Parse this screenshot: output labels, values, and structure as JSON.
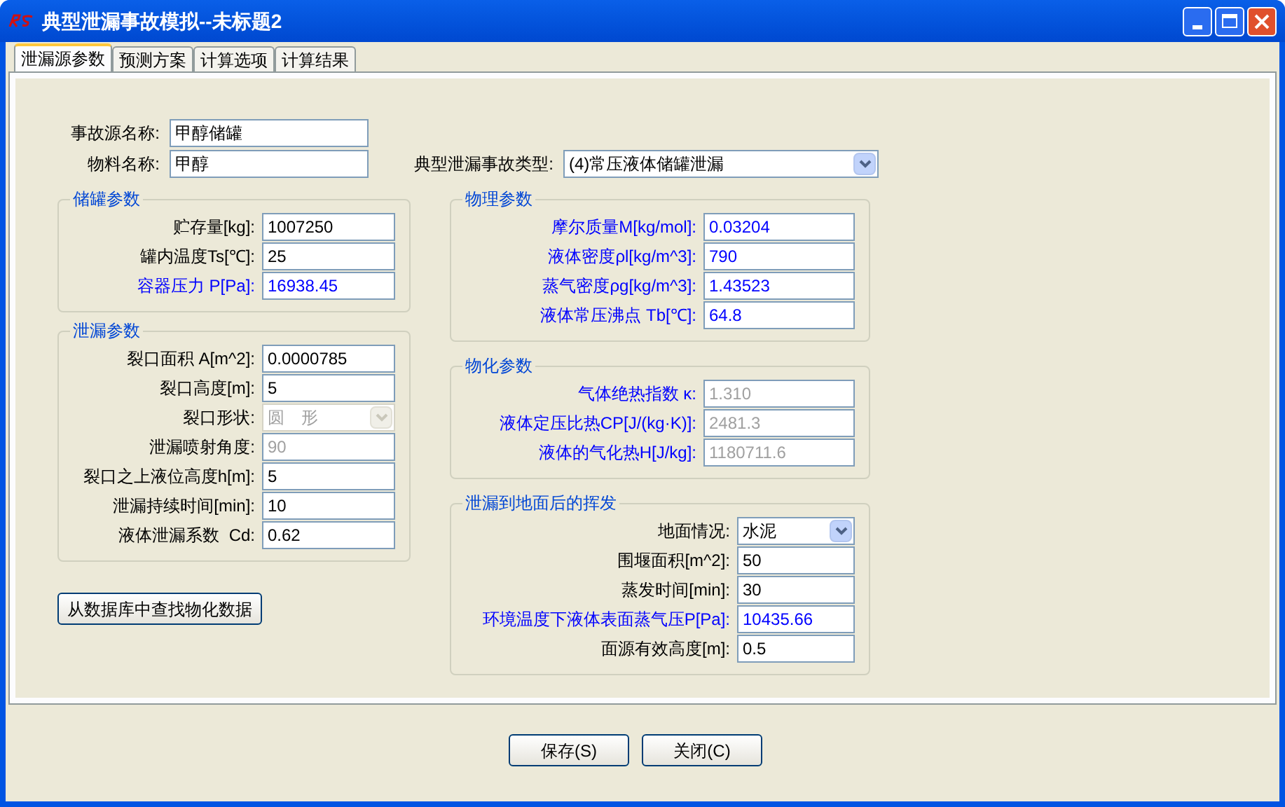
{
  "window": {
    "title": "典型泄漏事故模拟--未标题2"
  },
  "tabs": [
    {
      "label": "泄漏源参数",
      "selected": true
    },
    {
      "label": "预测方案",
      "selected": false
    },
    {
      "label": "计算选项",
      "selected": false
    },
    {
      "label": "计算结果",
      "selected": false
    }
  ],
  "source_fields": [
    {
      "label": "事故源名称:",
      "value": "甲醇储罐"
    },
    {
      "label": "物料名称:",
      "value": "甲醇"
    }
  ],
  "accident_type": {
    "label": "典型泄漏事故类型:",
    "value": "(4)常压液体储罐泄漏"
  },
  "columns": [
    {
      "groups": [
        {
          "title": "储罐参数",
          "fields": [
            {
              "kind": "text",
              "label": "贮存量[kg]:",
              "value": "1007250",
              "highlighted": false,
              "disabled": false
            },
            {
              "kind": "text",
              "label": "罐内温度Ts[℃]:",
              "value": "25",
              "highlighted": false,
              "disabled": false
            },
            {
              "kind": "text",
              "label": "容器压力 P[Pa]:",
              "value": "16938.45",
              "highlighted": true,
              "disabled": false
            }
          ]
        },
        {
          "title": "泄漏参数",
          "fields": [
            {
              "kind": "text",
              "label": "裂口面积 A[m^2]:",
              "value": "0.0000785",
              "highlighted": false,
              "disabled": false
            },
            {
              "kind": "text",
              "label": "裂口高度[m]:",
              "value": "5",
              "highlighted": false,
              "disabled": false
            },
            {
              "kind": "select",
              "label": "裂口形状:",
              "value": "圆　形",
              "highlighted": false,
              "disabled": true
            },
            {
              "kind": "text",
              "label": "泄漏喷射角度:",
              "value": "90",
              "highlighted": false,
              "disabled": true
            },
            {
              "kind": "text",
              "label": "裂口之上液位高度h[m]:",
              "value": "5",
              "highlighted": false,
              "disabled": false
            },
            {
              "kind": "text",
              "label": "泄漏持续时间[min]:",
              "value": "10",
              "highlighted": false,
              "disabled": false
            },
            {
              "kind": "text",
              "label": "液体泄漏系数  Cd:",
              "value": "0.62",
              "highlighted": false,
              "disabled": false
            }
          ]
        }
      ]
    },
    {
      "groups": [
        {
          "title": "物理参数",
          "fields": [
            {
              "kind": "text",
              "label": "摩尔质量M[kg/mol]:",
              "value": "0.03204",
              "highlighted": true,
              "disabled": false
            },
            {
              "kind": "text",
              "label": "液体密度ρl[kg/m^3]:",
              "value": "790",
              "highlighted": true,
              "disabled": false
            },
            {
              "kind": "text",
              "label": "蒸气密度ρg[kg/m^3]:",
              "value": "1.43523",
              "highlighted": true,
              "disabled": false
            },
            {
              "kind": "text",
              "label": "液体常压沸点 Tb[℃]:",
              "value": "64.8",
              "highlighted": true,
              "disabled": false
            }
          ]
        },
        {
          "title": "物化参数",
          "fields": [
            {
              "kind": "text",
              "label": "气体绝热指数 κ:",
              "value": "1.310",
              "highlighted": true,
              "disabled": true
            },
            {
              "kind": "text",
              "label": "液体定压比热CP[J/(kg·K)]:",
              "value": "2481.3",
              "highlighted": true,
              "disabled": true
            },
            {
              "kind": "text",
              "label": "液体的气化热H[J/kg]:",
              "value": "1180711.6",
              "highlighted": true,
              "disabled": true
            }
          ]
        },
        {
          "title": "泄漏到地面后的挥发",
          "fields": [
            {
              "kind": "select",
              "label": "地面情况:",
              "value": "水泥",
              "highlighted": false,
              "disabled": false
            },
            {
              "kind": "text",
              "label": "围堰面积[m^2]:",
              "value": "50",
              "highlighted": false,
              "disabled": false
            },
            {
              "kind": "text",
              "label": "蒸发时间[min]:",
              "value": "30",
              "highlighted": false,
              "disabled": false
            },
            {
              "kind": "text",
              "label": "环境温度下液体表面蒸气压P[Pa]:",
              "value": "10435.66",
              "highlighted": true,
              "disabled": false
            },
            {
              "kind": "text",
              "label": "面源有效高度[m]:",
              "value": "0.5",
              "highlighted": false,
              "disabled": false
            }
          ]
        }
      ]
    }
  ],
  "lookup_button": "从数据库中查找物化数据",
  "buttons": [
    "保存(S)",
    "关闭(C)"
  ]
}
